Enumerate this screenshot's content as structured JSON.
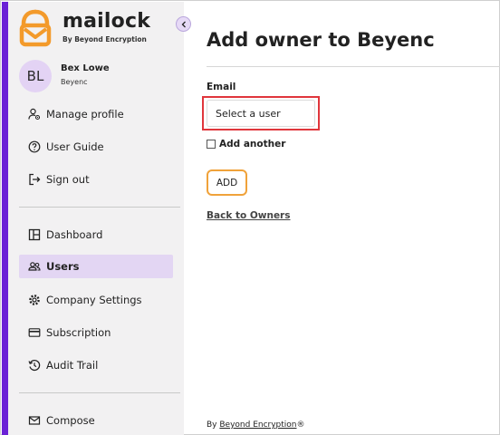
{
  "brand": {
    "name": "mailock",
    "tagline": "By Beyond Encryption",
    "accent_color": "#6b22d6",
    "logo_color": "#f39a2b"
  },
  "user": {
    "initials": "BL",
    "name": "Bex Lowe",
    "organization": "Beyenc"
  },
  "sidebar": {
    "profile_items": [
      {
        "label": "Manage profile",
        "icon": "manage-profile-icon"
      },
      {
        "label": "User Guide",
        "icon": "help-icon"
      },
      {
        "label": "Sign out",
        "icon": "sign-out-icon"
      }
    ],
    "nav_items": [
      {
        "label": "Dashboard",
        "icon": "dashboard-icon"
      },
      {
        "label": "Users",
        "icon": "users-icon",
        "active": true
      },
      {
        "label": "Company Settings",
        "icon": "gear-icon"
      },
      {
        "label": "Subscription",
        "icon": "card-icon"
      },
      {
        "label": "Audit Trail",
        "icon": "history-icon"
      }
    ],
    "bottom_items": [
      {
        "label": "Compose",
        "icon": "mail-icon"
      }
    ]
  },
  "main": {
    "title_prefix": "Add owner to ",
    "title_org": "Beyenc",
    "email_label": "Email",
    "select_placeholder": "Select a user",
    "add_another_label": "Add another",
    "add_another_checked": false,
    "add_button_label": "ADD",
    "back_link": "Back to Owners",
    "highlight_color": "#e0363c",
    "button_border_color": "#f0a23a"
  },
  "footer": {
    "prefix": "By ",
    "link": "Beyond Encryption",
    "suffix": "®"
  }
}
